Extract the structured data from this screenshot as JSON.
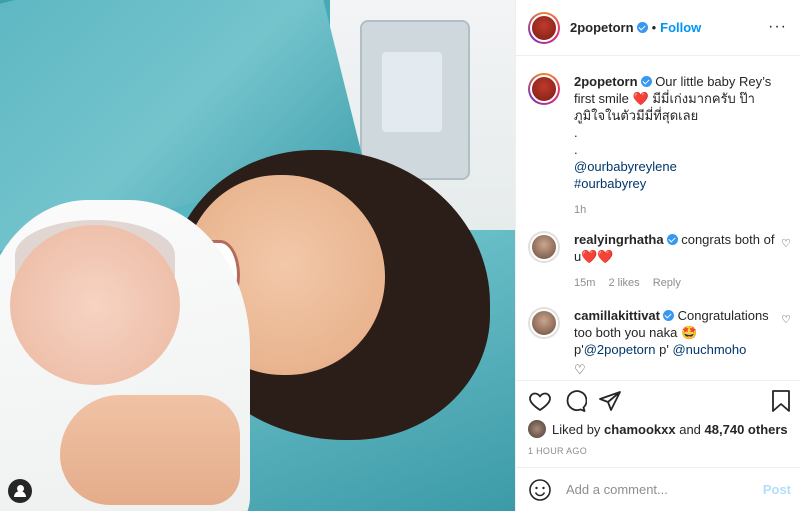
{
  "post": {
    "author": "2popetorn",
    "follow_label": "Follow",
    "dot": "•",
    "more_label": "···"
  },
  "caption": {
    "username": "2popetorn",
    "text_part1": "Our little baby Rey’s first smile",
    "heart": "❤️",
    "text_thai": "มีมี่เก่งมากครับ ป๊าภูมิใจในตัวมีมี่ที่สุดเลย",
    "dot1": ".",
    "dot2": ".",
    "mention": "@ourbabyreylene",
    "hashtag": "#ourbabyrey",
    "time": "1h"
  },
  "comments": [
    {
      "username": "realyingrhatha",
      "text": "congrats both of u",
      "hearts": "❤️❤️",
      "time": "15m",
      "likes": "2 likes",
      "reply": "Reply"
    },
    {
      "username": "camillakittivat",
      "text": "Congratulations too both you naka",
      "emoji": "🤩",
      "p1": "p'",
      "mention1": "@2popetorn",
      "p2": "p'",
      "mention2": "@nuchmoho"
    }
  ],
  "likes": {
    "prefix": "Liked by",
    "user": "chamookxx",
    "and": "and",
    "count": "48,740 others"
  },
  "timestamp": "1 HOUR AGO",
  "add_comment": {
    "placeholder": "Add a comment...",
    "post_label": "Post"
  },
  "icons": [
    "heart-icon",
    "comment-icon",
    "share-icon",
    "bookmark-icon",
    "emoji-icon",
    "tag-user-icon",
    "more-icon"
  ],
  "colors": {
    "link": "#00376b",
    "follow": "#0095f6",
    "verified": "#3897f0",
    "post_disabled": "#b2dffc"
  }
}
